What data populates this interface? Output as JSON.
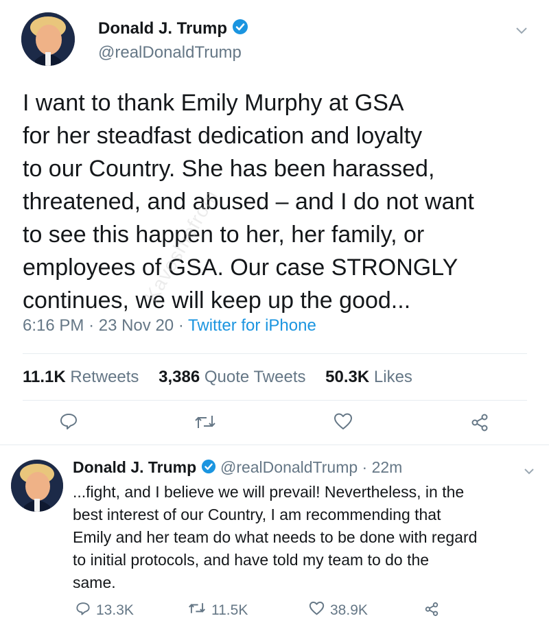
{
  "tweet": {
    "author_name": "Donald J. Trump",
    "handle": "@realDonaldTrump",
    "text_lines": [
      "I want to thank Emily Murphy at GSA",
      "for her steadfast dedication and loyalty",
      "to our Country. She has been harassed,",
      "threatened, and abused – and I do not want",
      "to see this happen to her, her family, or",
      "employees of GSA. Our case STRONGLY",
      "continues, we will keep up the good..."
    ],
    "time": "6:16 PM",
    "sep1": "·",
    "date": "23 Nov 20",
    "sep2": "·",
    "source": "Twitter for iPhone",
    "stats": {
      "retweets_count": "11.1K",
      "retweets_label": "Retweets",
      "quotes_count": "3,386",
      "quotes_label": "Quote Tweets",
      "likes_count": "50.3K",
      "likes_label": "Likes"
    }
  },
  "reply": {
    "author_name": "Donald J. Trump",
    "handle_time": "@realDonaldTrump · 22m",
    "text_lines": [
      "...fight, and I believe we will prevail! Nevertheless, in the",
      "best interest of our Country, I am recommending that",
      "Emily and her team do what needs to be done with regard",
      "to initial protocols, and have told my team to do the",
      "same."
    ],
    "reply_count": "13.3K",
    "retweet_count": "11.5K",
    "like_count": "38.9K"
  },
  "colors": {
    "accent": "#1b95e0",
    "muted": "#657786",
    "text": "#14171a",
    "divider": "#e6ecf0"
  },
  "icons": [
    "verified-icon",
    "chevron-down-icon",
    "reply-icon",
    "retweet-icon",
    "like-icon",
    "share-icon"
  ],
  "watermark": "Kavoshiefrom"
}
